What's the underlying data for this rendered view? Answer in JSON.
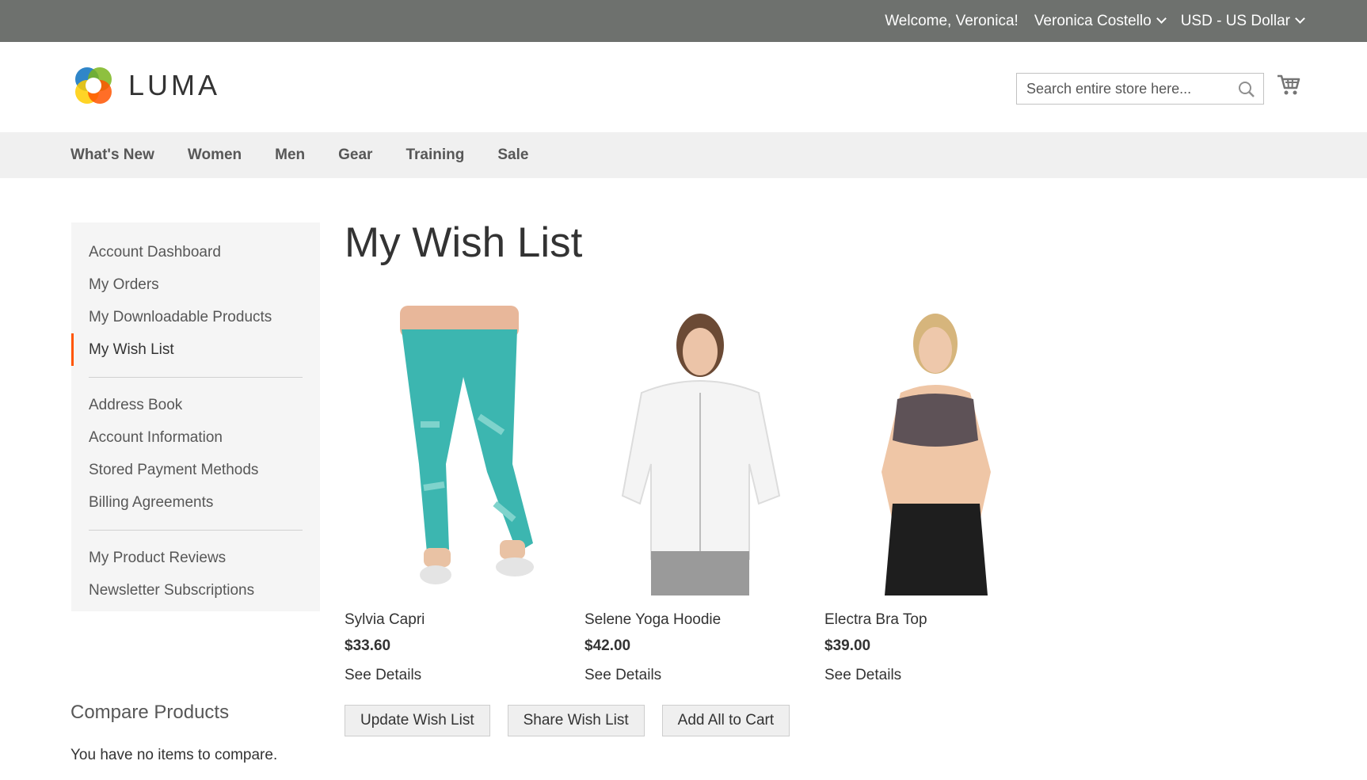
{
  "topbar": {
    "welcome": "Welcome, Veronica!",
    "account_name": "Veronica Costello",
    "currency": "USD - US Dollar"
  },
  "header": {
    "logo_text": "LUMA",
    "search_placeholder": "Search entire store here..."
  },
  "nav": {
    "items": [
      "What's New",
      "Women",
      "Men",
      "Gear",
      "Training",
      "Sale"
    ]
  },
  "sidebar": {
    "groups": [
      [
        "Account Dashboard",
        "My Orders",
        "My Downloadable Products",
        "My Wish List"
      ],
      [
        "Address Book",
        "Account Information",
        "Stored Payment Methods",
        "Billing Agreements"
      ],
      [
        "My Product Reviews",
        "Newsletter Subscriptions"
      ]
    ],
    "active": "My Wish List"
  },
  "page": {
    "title": "My Wish List"
  },
  "products": [
    {
      "name": "Sylvia Capri",
      "price": "$33.60",
      "details": "See Details"
    },
    {
      "name": "Selene Yoga Hoodie",
      "price": "$42.00",
      "details": "See Details"
    },
    {
      "name": "Electra Bra Top",
      "price": "$39.00",
      "details": "See Details"
    }
  ],
  "actions": {
    "update": "Update Wish List",
    "share": "Share Wish List",
    "add_all": "Add All to Cart"
  },
  "compare": {
    "title": "Compare Products",
    "empty": "You have no items to compare."
  },
  "colors": {
    "topbar": "#6e716e",
    "nav_bg": "#f0f0f0",
    "sidebar_bg": "#f5f5f5",
    "active_accent": "#ff5501"
  }
}
